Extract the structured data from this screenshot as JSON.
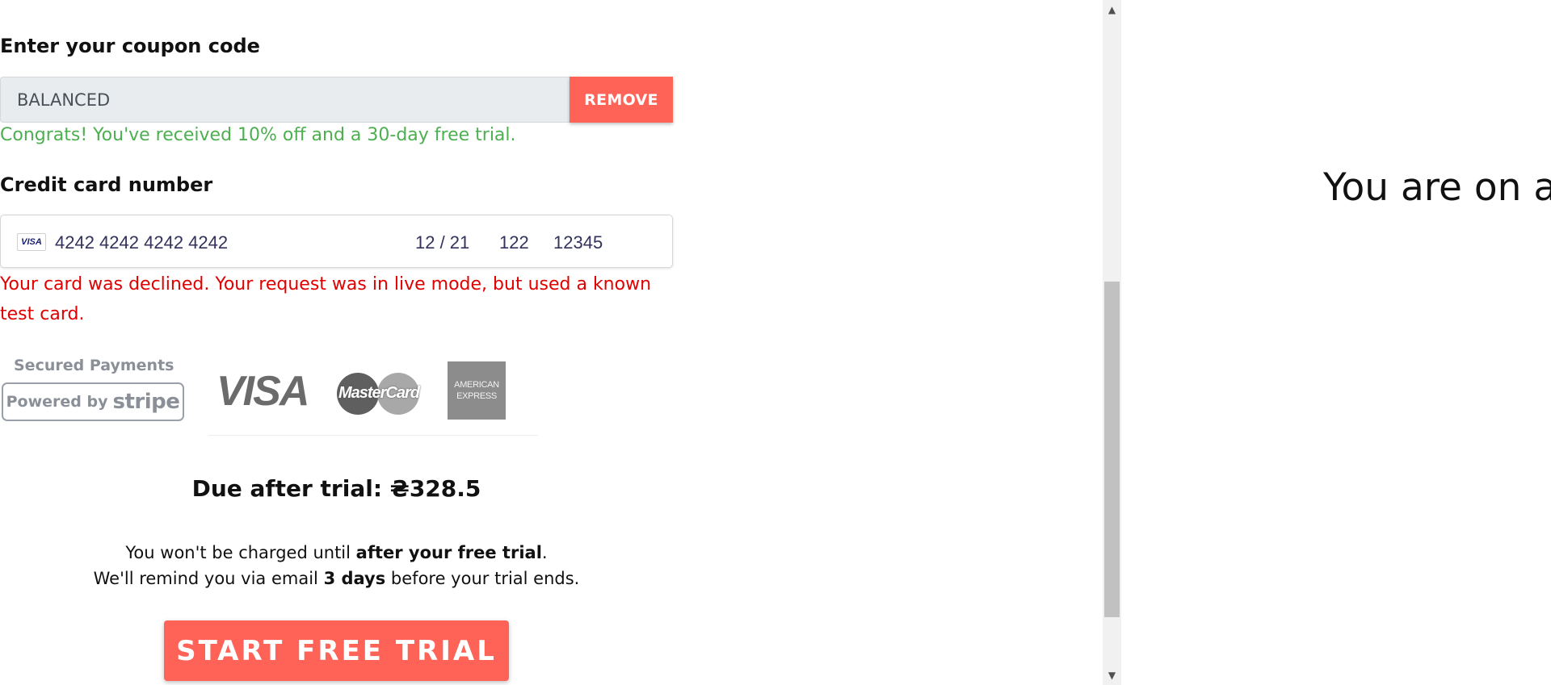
{
  "coupon": {
    "heading": "Enter your coupon code",
    "value": "BALANCED",
    "remove_label": "REMOVE",
    "success_message": "Congrats! You've received 10% off and a 30-day free trial."
  },
  "credit_card": {
    "heading": "Credit card number",
    "brand_badge": "VISA",
    "number": "4242 4242 4242 4242",
    "expiry": "12 / 21",
    "cvc": "122",
    "zip": "12345",
    "error_message": "Your card was declined. Your request was in live mode, but used a known test card."
  },
  "payment_badges": {
    "secured_label": "Secured Payments",
    "powered_by": "Powered by",
    "stripe_word": "stripe",
    "visa": "VISA",
    "mastercard": "MasterCard",
    "amex_line1": "AMERICAN",
    "amex_line2": "EXPRESS"
  },
  "summary": {
    "due_title": "Due after trial: ₴328.5",
    "line1_prefix": "You won't be charged until ",
    "line1_bold": "after your free trial",
    "line1_suffix": ".",
    "line2_prefix": "We'll remind you via email ",
    "line2_bold": "3 days",
    "line2_suffix": " before your trial ends."
  },
  "cta": {
    "label": "START FREE TRIAL"
  },
  "right_panel": {
    "heading": "You are on a"
  },
  "colors": {
    "accent": "#ff6257",
    "success": "#4caf50",
    "error": "#e00000"
  }
}
